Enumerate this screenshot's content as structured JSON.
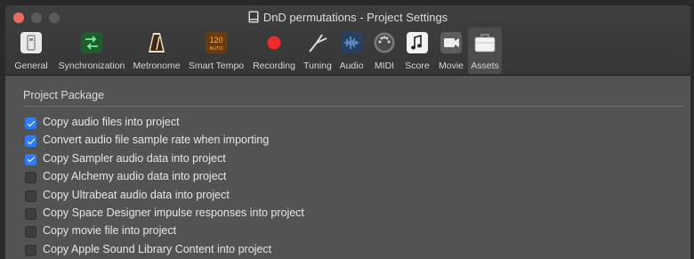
{
  "window": {
    "title": "DnD permutations - Project Settings"
  },
  "toolbar": {
    "items": [
      {
        "label": "General",
        "icon": "general-icon"
      },
      {
        "label": "Synchronization",
        "icon": "sync-icon"
      },
      {
        "label": "Metronome",
        "icon": "metronome-icon"
      },
      {
        "label": "Smart Tempo",
        "icon": "smart-tempo-icon",
        "icon_text": "120",
        "icon_subtext": "AUTO"
      },
      {
        "label": "Recording",
        "icon": "record-icon"
      },
      {
        "label": "Tuning",
        "icon": "tuning-fork-icon"
      },
      {
        "label": "Audio",
        "icon": "audio-waveform-icon"
      },
      {
        "label": "MIDI",
        "icon": "midi-icon"
      },
      {
        "label": "Score",
        "icon": "score-note-icon"
      },
      {
        "label": "Movie",
        "icon": "movie-camera-icon"
      },
      {
        "label": "Assets",
        "icon": "assets-briefcase-icon",
        "active": true
      }
    ]
  },
  "section": {
    "title": "Project Package",
    "options": [
      {
        "label": "Copy audio files into project",
        "checked": true
      },
      {
        "label": "Convert audio file sample rate when importing",
        "checked": true
      },
      {
        "label": "Copy Sampler audio data into project",
        "checked": true
      },
      {
        "label": "Copy Alchemy audio data into project",
        "checked": false
      },
      {
        "label": "Copy Ultrabeat audio data into project",
        "checked": false
      },
      {
        "label": "Copy Space Designer impulse responses into project",
        "checked": false
      },
      {
        "label": "Copy movie file into project",
        "checked": false
      },
      {
        "label": "Copy Apple Sound Library Content into project",
        "checked": false
      }
    ]
  },
  "colors": {
    "accent": "#2f7df6",
    "close_button": "#ed6a5e",
    "window_background": "#535353"
  }
}
